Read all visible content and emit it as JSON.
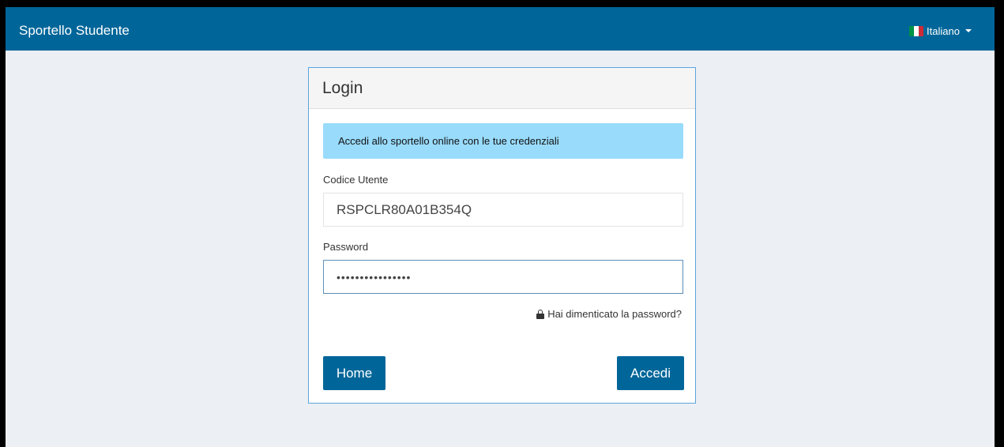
{
  "navbar": {
    "brand": "Sportello Studente",
    "language": "Italiano",
    "flag_colors": [
      "#009246",
      "#ffffff",
      "#ce2b37"
    ]
  },
  "login": {
    "title": "Login",
    "info": "Accedi allo sportello online con le tue credenziali",
    "username_label": "Codice Utente",
    "username_value": "RSPCLR80A01B354Q",
    "password_label": "Password",
    "password_value": "••••••••••••••••",
    "forgot_link": "Hai dimenticato la password?",
    "home_button": "Home",
    "submit_button": "Accedi"
  },
  "colors": {
    "primary": "#006699",
    "info_bg": "#99dbfb",
    "page_bg": "#eceff4"
  }
}
